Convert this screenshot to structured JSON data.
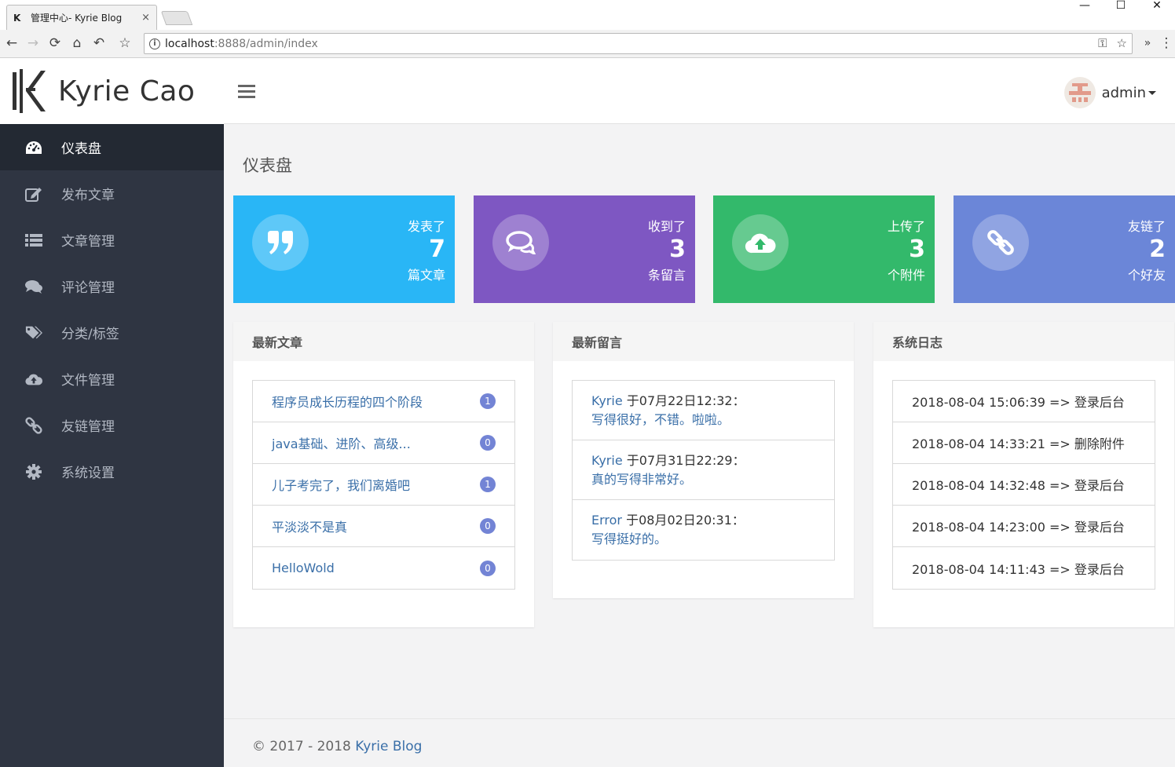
{
  "browser": {
    "tab_title": "管理中心- Kyrie Blog",
    "tab_close": "×",
    "url_host": "localhost",
    "url_path": ":8888/admin/index",
    "win_min": "—",
    "win_max": "☐",
    "win_close": "✕"
  },
  "brand": {
    "name": "Kyrie Cao"
  },
  "sidebar": {
    "items": [
      {
        "label": "仪表盘",
        "icon": "dashboard-icon"
      },
      {
        "label": "发布文章",
        "icon": "edit-icon"
      },
      {
        "label": "文章管理",
        "icon": "list-icon"
      },
      {
        "label": "评论管理",
        "icon": "comments-icon"
      },
      {
        "label": "分类/标签",
        "icon": "tags-icon"
      },
      {
        "label": "文件管理",
        "icon": "cloud-upload-icon"
      },
      {
        "label": "友链管理",
        "icon": "link-icon"
      },
      {
        "label": "系统设置",
        "icon": "gear-icon"
      }
    ]
  },
  "header": {
    "username": "admin"
  },
  "page": {
    "title": "仪表盘"
  },
  "stats": [
    {
      "label": "发表了",
      "value": "7",
      "unit": "篇文章",
      "color": "#29b6f6",
      "icon": "quote-icon"
    },
    {
      "label": "收到了",
      "value": "3",
      "unit": "条留言",
      "color": "#7e57c2",
      "icon": "comments-icon"
    },
    {
      "label": "上传了",
      "value": "3",
      "unit": "个附件",
      "color": "#33b96b",
      "icon": "cloud-upload-icon"
    },
    {
      "label": "友链了",
      "value": "2",
      "unit": "个好友",
      "color": "#6b86d8",
      "icon": "link-icon"
    }
  ],
  "panels": {
    "articles": {
      "title": "最新文章",
      "rows": [
        {
          "title": "程序员成长历程的四个阶段",
          "count": "1"
        },
        {
          "title": "java基础、进阶、高级...",
          "count": "0"
        },
        {
          "title": "儿子考完了，我们离婚吧",
          "count": "1"
        },
        {
          "title": "平淡淡不是真",
          "count": "0"
        },
        {
          "title": "HelloWold",
          "count": "0"
        }
      ]
    },
    "comments": {
      "title": "最新留言",
      "rows": [
        {
          "author": "Kyrie",
          "meta": " 于07月22日12:32：",
          "text": "写得很好，不错。啦啦。"
        },
        {
          "author": "Kyrie",
          "meta": " 于07月31日22:29：",
          "text": "真的写得非常好。"
        },
        {
          "author": "Error",
          "meta": " 于08月02日20:31：",
          "text": "写得挺好的。"
        }
      ]
    },
    "logs": {
      "title": "系统日志",
      "rows": [
        {
          "text": "2018-08-04 15:06:39 => 登录后台"
        },
        {
          "text": "2018-08-04 14:33:21 => 删除附件"
        },
        {
          "text": "2018-08-04 14:32:48 => 登录后台"
        },
        {
          "text": "2018-08-04 14:23:00 => 登录后台"
        },
        {
          "text": "2018-08-04 14:11:43 => 登录后台"
        }
      ]
    }
  },
  "footer": {
    "copyright": "© 2017 - 2018 ",
    "link": "Kyrie Blog"
  }
}
